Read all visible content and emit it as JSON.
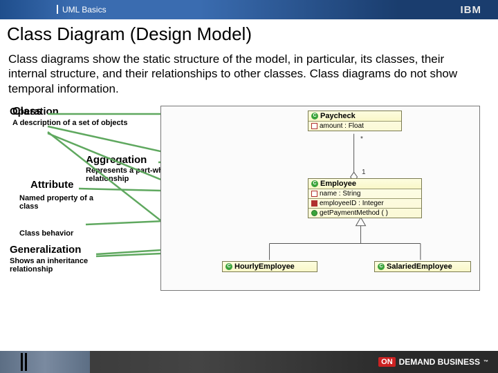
{
  "header": {
    "breadcrumb": "UML Basics",
    "logo": "IBM"
  },
  "title": "Class Diagram (Design Model)",
  "body": "Class diagrams show the static structure of the model, in particular, its classes, their internal structure, and their relationships to other classes. Class diagrams do not show temporal information.",
  "labels": {
    "class": {
      "title": "Class",
      "desc": "A description of a set of objects"
    },
    "aggregation": {
      "title": "Aggregation",
      "desc": "Represents a part-whole relationship"
    },
    "attribute": {
      "title": "Attribute",
      "desc": "Named property of a class"
    },
    "operation": {
      "title": "Operation",
      "desc": "Class behavior"
    },
    "generalization": {
      "title": "Generalization",
      "desc": "Shows an inheritance relationship"
    }
  },
  "uml": {
    "paycheck": {
      "name": "Paycheck",
      "attr1": "amount : Float"
    },
    "employee": {
      "name": "Employee",
      "attr1": "name : String",
      "attr2": "employeeID : Integer",
      "op1": "getPaymentMethod ( )"
    },
    "hourly": {
      "name": "HourlyEmployee"
    },
    "salaried": {
      "name": "SalariedEmployee"
    },
    "mult_star": "*",
    "mult_one": "1"
  },
  "footer": {
    "on": "ON",
    "demand": "DEMAND BUSINESS",
    "tm": "™"
  }
}
